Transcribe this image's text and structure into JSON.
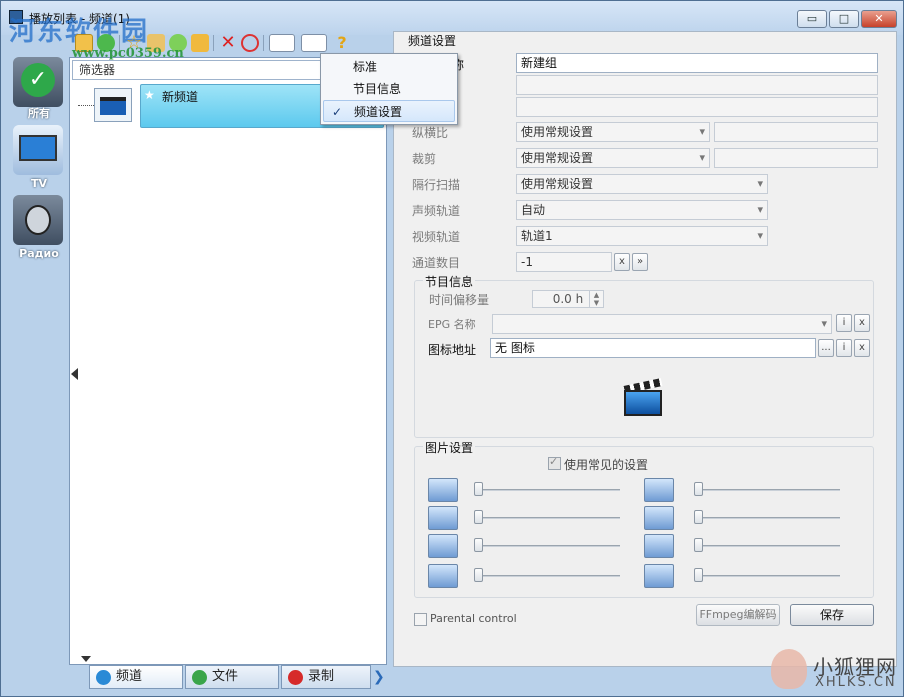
{
  "window": {
    "title": "播放列表 - 频道(1)",
    "watermark_main": "河东软件园",
    "watermark_url": "www.pc0359.cn",
    "buttons": {
      "minimize": "▭",
      "maximize": "□",
      "close": "✕"
    }
  },
  "categories": [
    {
      "label": "所有",
      "icon": "checkmark-icon",
      "color": "#2ea84a"
    },
    {
      "label": "TV",
      "icon": "tv-icon",
      "color": "#2a7fd6"
    },
    {
      "label": "Радио",
      "icon": "radio-icon",
      "color": "#555555"
    }
  ],
  "list": {
    "filter_placeholder": "筛选器",
    "items": [
      {
        "name": "新频道"
      }
    ]
  },
  "menu": {
    "items": [
      {
        "label": "标准",
        "checked": false
      },
      {
        "label": "节目信息",
        "checked": false
      },
      {
        "label": "频道设置",
        "checked": true
      }
    ],
    "check_glyph": "✓"
  },
  "tabs": [
    {
      "label": "频道",
      "icon": "globe-icon",
      "active": true
    },
    {
      "label": "文件",
      "icon": "folder-icon",
      "active": false
    },
    {
      "label": "录制",
      "icon": "record-icon",
      "active": false
    }
  ],
  "settings": {
    "panel_title": "频道设置",
    "name_label": "称",
    "name_value": "新建组",
    "aspect_label": "纵横比",
    "aspect_value": "使用常规设置",
    "crop_label": "裁剪",
    "crop_value": "使用常规设置",
    "deinterlace_label": "隔行扫描",
    "deinterlace_value": "使用常规设置",
    "audio_label": "声频轨道",
    "audio_value": "自动",
    "video_label": "视频轨道",
    "video_value": "轨道1",
    "channel_count_label": "通道数目",
    "channel_count_value": "-1",
    "x_label": "x",
    "more_label": "»",
    "epg_group": {
      "title": "节目信息",
      "offset_label": "时间偏移量",
      "offset_value": "0.0 h",
      "epg_name_label": "EPG 名称",
      "icon_url_label": "图标地址",
      "icon_url_value": "无 图标",
      "browse_label": "...",
      "info_label": "i"
    },
    "picture_group": {
      "title": "图片设置",
      "use_common_label": "使用常见的设置",
      "sliders_left": [
        {
          "icon": "brightness-icon",
          "value": 0
        },
        {
          "icon": "contrast-icon",
          "value": 0
        },
        {
          "icon": "gamma-icon",
          "value": 0
        },
        {
          "icon": "aspect-icon",
          "value": 0
        }
      ],
      "sliders_right": [
        {
          "icon": "saturation-icon",
          "value": 0
        },
        {
          "icon": "hue-icon",
          "value": 0
        },
        {
          "icon": "sharpness-icon",
          "value": 0
        },
        {
          "icon": "volume-icon",
          "value": 0
        }
      ]
    },
    "parental_label": "Parental control",
    "ffmpeg_button": "FFmpeg编解码",
    "save_button": "保存"
  },
  "corner_watermark": {
    "cn": "小狐狸网",
    "en": "XHLKS.CN"
  }
}
